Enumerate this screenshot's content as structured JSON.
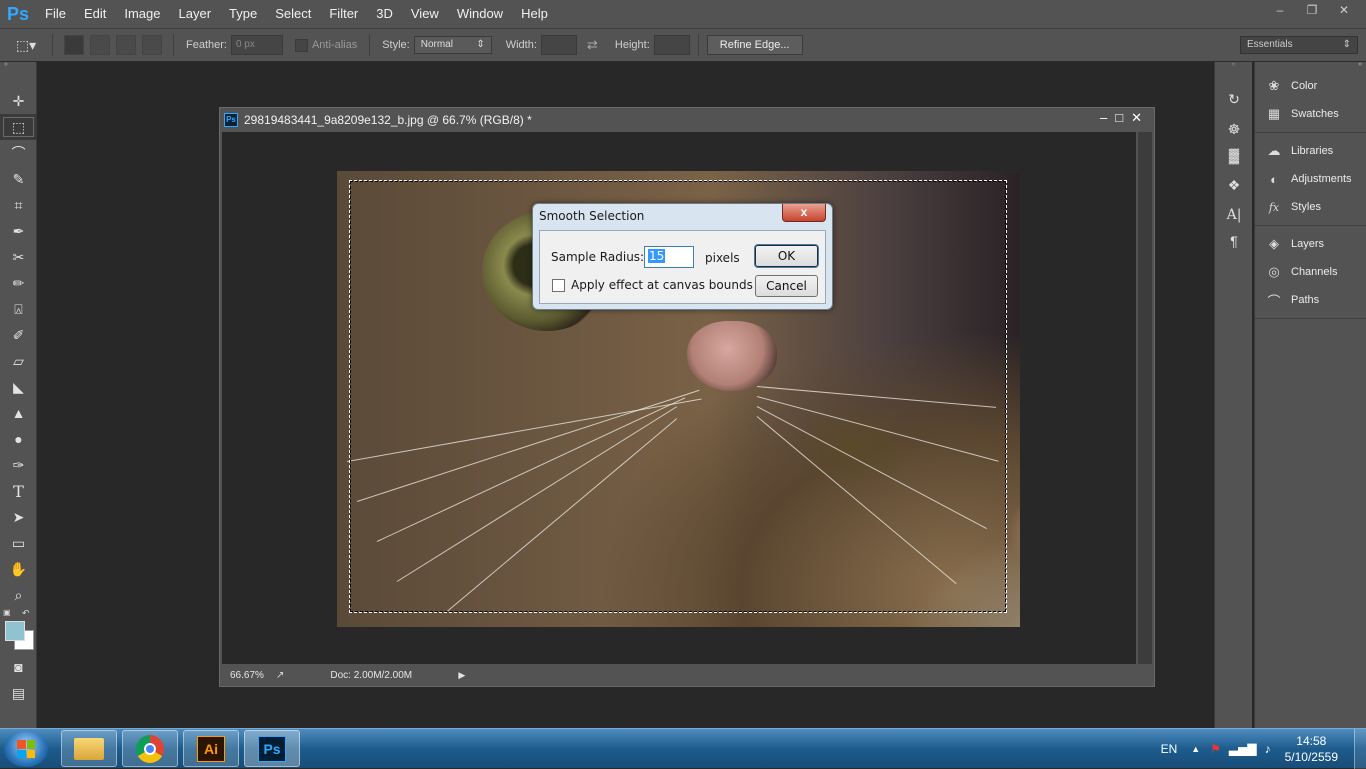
{
  "menubar": {
    "logo": "Ps",
    "items": [
      "File",
      "Edit",
      "Image",
      "Layer",
      "Type",
      "Select",
      "Filter",
      "3D",
      "View",
      "Window",
      "Help"
    ]
  },
  "optionsbar": {
    "feather_label": "Feather:",
    "feather_value": "0 px",
    "antialias_label": "Anti-alias",
    "style_label": "Style:",
    "style_value": "Normal",
    "width_label": "Width:",
    "height_label": "Height:",
    "refine_label": "Refine Edge...",
    "workspace_value": "Essentials"
  },
  "document": {
    "title": "29819483441_9a8209e132_b.jpg @ 66.7% (RGB/8) *",
    "zoom": "66.67%",
    "doc_size": "Doc: 2.00M/2.00M"
  },
  "dialog": {
    "title": "Smooth Selection",
    "close": "x",
    "radius_label": "Sample Radius:",
    "radius_value": "15",
    "unit": "pixels",
    "checkbox_label": "Apply effect at canvas bounds",
    "ok_label": "OK",
    "cancel_label": "Cancel"
  },
  "panels": {
    "group1": [
      "Color",
      "Swatches"
    ],
    "group2": [
      "Libraries",
      "Adjustments",
      "Styles"
    ],
    "group3": [
      "Layers",
      "Channels",
      "Paths"
    ]
  },
  "taskbar": {
    "apps": [
      "file-explorer",
      "chrome",
      "illustrator",
      "photoshop"
    ],
    "ai_label": "Ai",
    "ps_label": "Ps",
    "lang": "EN",
    "time": "14:58",
    "date": "5/10/2559"
  },
  "colors": {
    "ui_dark": "#535353",
    "workspace": "#282828",
    "ps_blue": "#31a8ff",
    "foreground_swatch": "#8fc3cf",
    "background_swatch": "#ffffff"
  }
}
